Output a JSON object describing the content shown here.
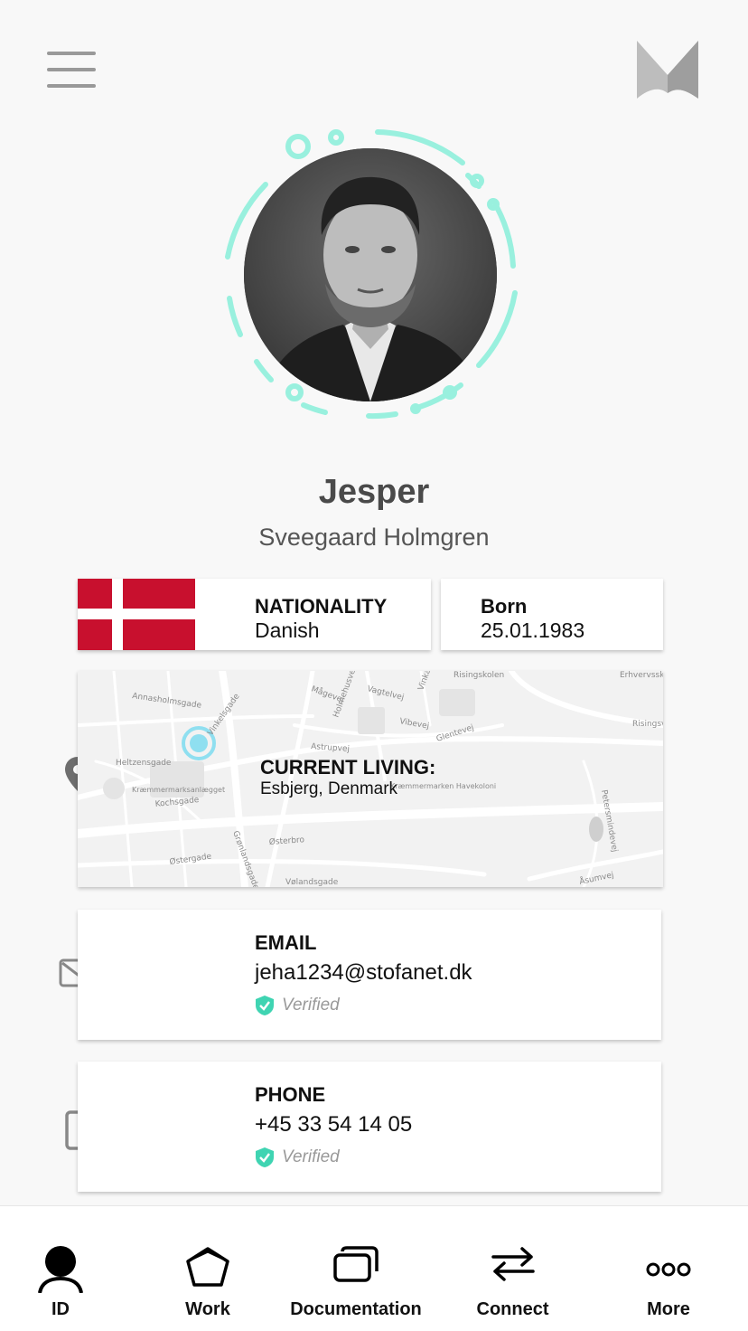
{
  "header": {
    "menu_icon": "hamburger-menu-icon",
    "logo_icon": "brand-logo-icon"
  },
  "profile": {
    "first_name": "Jesper",
    "last_name": "Sveegaard Holmgren",
    "ring_color": "#8ff0dc"
  },
  "nationality": {
    "label": "NATIONALITY",
    "value": "Danish",
    "flag_icon": "denmark-flag-icon"
  },
  "born": {
    "label": "Born",
    "value": "25.01.1983"
  },
  "location": {
    "label": "CURRENT LIVING:",
    "value": "Esbjerg, Denmark",
    "icon": "location-pin-icon",
    "map_labels": [
      "Annasholmsgade",
      "Vinkelsgade",
      "Heltzensgade",
      "Kræmmermarksanlægget",
      "Kochsgade",
      "Østergade",
      "Grønlandsgade",
      "Østerbro",
      "Vølandsgade",
      "Astrupvej",
      "Mågevej",
      "Holmehusvej",
      "Vagtelvej",
      "Vibevej",
      "Glentevej",
      "Vinkæ",
      "Risingskolen",
      "Erhvervsskolen",
      "Risingsvej",
      "Kræmmermarken Havekoloni",
      "Petersmindevej",
      "Åsumvej"
    ]
  },
  "email": {
    "label": "EMAIL",
    "value": "jeha1234@stofanet.dk",
    "verified": "Verified",
    "icon": "mail-icon"
  },
  "phone": {
    "label": "PHONE",
    "value": "+45 33 54 14 05",
    "verified": "Verified",
    "icon": "phone-icon"
  },
  "colors": {
    "verified_check": "#3fd4b2",
    "flag_red": "#c8102e"
  },
  "nav": [
    {
      "label": "ID",
      "icon": "person-icon"
    },
    {
      "label": "Work",
      "icon": "work-pentagon-icon"
    },
    {
      "label": "Documentation",
      "icon": "documents-icon"
    },
    {
      "label": "Connect",
      "icon": "swap-arrows-icon"
    },
    {
      "label": "More",
      "icon": "more-dots-icon"
    }
  ]
}
